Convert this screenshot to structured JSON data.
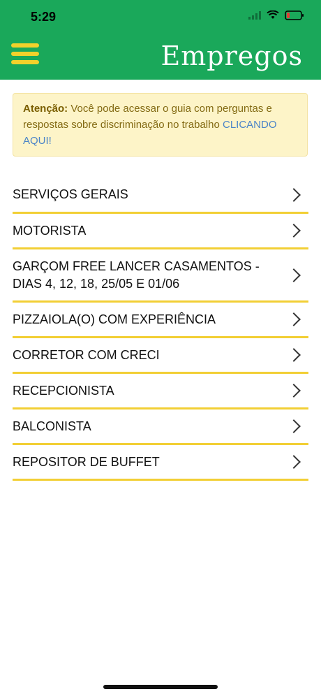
{
  "status": {
    "time": "5:29"
  },
  "header": {
    "title": "Empregos",
    "menu_icon": "hamburger-menu-icon"
  },
  "alert": {
    "bold": "Atenção:",
    "text": " Você pode acessar o guia com perguntas e respostas sobre discriminação no trabalho ",
    "link": "CLICANDO AQUI!"
  },
  "jobs": [
    {
      "label": "SERVIÇOS GERAIS"
    },
    {
      "label": "MOTORISTA"
    },
    {
      "label": "GARÇOM FREE LANCER CASAMENTOS - DIAS 4, 12, 18, 25/05 E 01/06"
    },
    {
      "label": "PIZZAIOLA(O) COM EXPERIÊNCIA"
    },
    {
      "label": "CORRETOR COM CRECI"
    },
    {
      "label": "RECEPCIONISTA"
    },
    {
      "label": "BALCONISTA"
    },
    {
      "label": "REPOSITOR DE BUFFET"
    }
  ],
  "colors": {
    "brand_green": "#1aa85a",
    "accent_yellow": "#f2cf35",
    "alert_bg": "#fdf4c8",
    "link": "#4b84c8"
  }
}
